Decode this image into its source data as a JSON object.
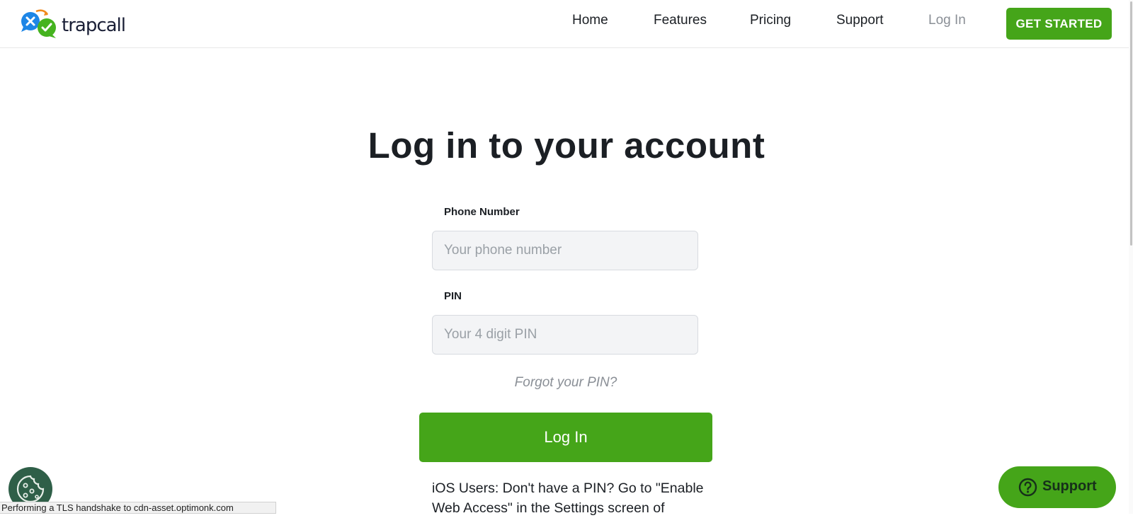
{
  "brand": {
    "name": "trapcall",
    "accent": "#45a519"
  },
  "nav": {
    "items": [
      {
        "label": "Home"
      },
      {
        "label": "Features"
      },
      {
        "label": "Pricing"
      },
      {
        "label": "Support"
      },
      {
        "label": "Log In"
      }
    ],
    "cta_label": "GET STARTED"
  },
  "login": {
    "title": "Log in to your account",
    "phone": {
      "label": "Phone Number",
      "placeholder": "Your phone number",
      "value": ""
    },
    "pin": {
      "label": "PIN",
      "placeholder": "Your 4 digit PIN",
      "value": ""
    },
    "forgot_label": "Forgot your PIN?",
    "submit_label": "Log In",
    "ios_note": "iOS Users: Don't have a PIN? Go to \"Enable Web Access\" in the Settings screen of"
  },
  "support_widget": {
    "label": "Support",
    "icon": "question-circle-icon"
  },
  "cookie_widget": {
    "icon": "cookie-icon"
  },
  "status_bar": {
    "text": "Performing a TLS handshake to cdn-asset.optimonk.com"
  }
}
